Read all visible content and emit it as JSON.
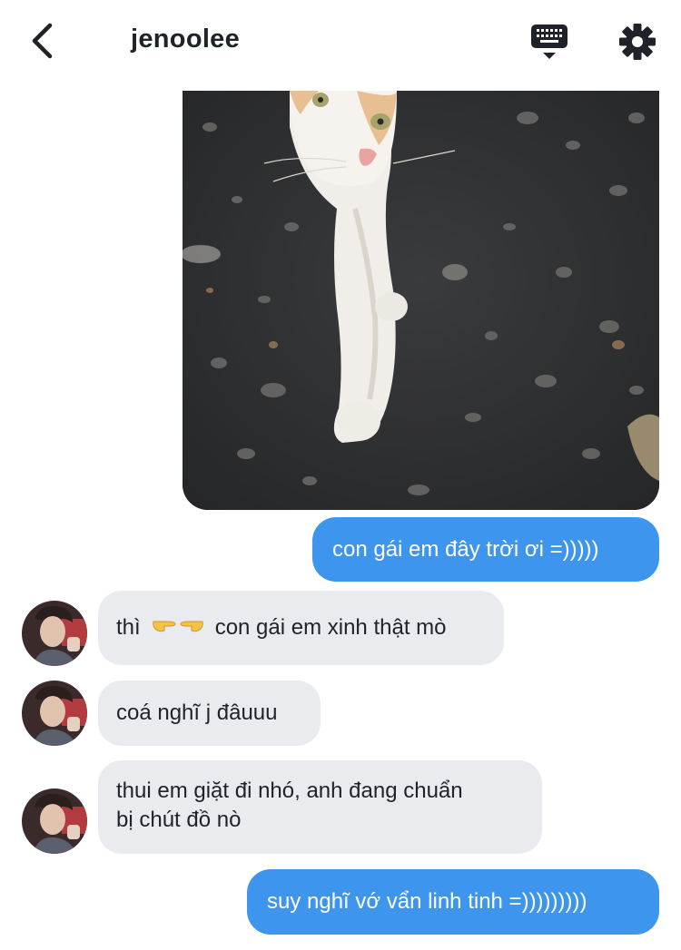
{
  "header": {
    "username": "jenoolee"
  },
  "messages": [
    {
      "from": "me",
      "type": "image",
      "image": "cat photo"
    },
    {
      "from": "me",
      "type": "text",
      "text": "con gái em đây trời ơi =)))))"
    },
    {
      "from": "them",
      "type": "text",
      "prefix": "thì",
      "suffix": "con gái em xinh thật mò",
      "emojis": [
        "backhand-index-right",
        "backhand-index-left"
      ]
    },
    {
      "from": "them",
      "type": "text",
      "text": "coá nghĩ j đâuuu"
    },
    {
      "from": "them",
      "type": "text",
      "line1": "thui em giặt đi nhó, anh đang chuẩn",
      "line2": "bị chút đồ nò"
    },
    {
      "from": "me",
      "type": "text",
      "text": "suy nghĩ vớ vẩn linh tinh =)))))))))"
    }
  ],
  "colors": {
    "outgoing_bubble": "#3d95ee",
    "incoming_bubble": "#e9ebee",
    "text": "#1f2329"
  },
  "icons": {
    "back": "chevron-left-icon",
    "keyboard": "keyboard-icon",
    "settings": "gear-icon"
  }
}
